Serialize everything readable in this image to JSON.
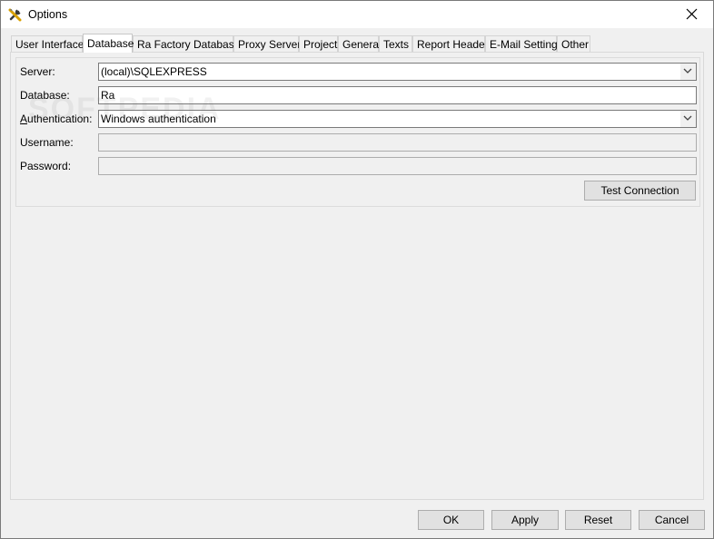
{
  "window": {
    "title": "Options"
  },
  "tabs": [
    {
      "label": "User Interface"
    },
    {
      "label": "Database"
    },
    {
      "label": "Ra Factory Database"
    },
    {
      "label": "Proxy Server"
    },
    {
      "label": "Project"
    },
    {
      "label": "General"
    },
    {
      "label": "Texts"
    },
    {
      "label": "Report Header"
    },
    {
      "label": "E-Mail Settings"
    },
    {
      "label": "Other"
    }
  ],
  "active_tab": "Database",
  "form": {
    "server": {
      "label": "Server:",
      "value": "(local)\\SQLEXPRESS"
    },
    "database": {
      "label": "Database:",
      "value": "Ra"
    },
    "authentication": {
      "label_prefix": "A",
      "label_rest": "uthentication:",
      "value": "Windows authentication"
    },
    "username": {
      "label": "Username:",
      "value": ""
    },
    "password": {
      "label": "Password:",
      "value": ""
    },
    "test_connection_label": "Test Connection"
  },
  "buttons": {
    "ok": "OK",
    "apply": "Apply",
    "reset": "Reset",
    "cancel": "Cancel"
  },
  "watermark": "SOFTPEDIA",
  "icons": {
    "app": "tools-icon",
    "close": "close-icon",
    "dropdown": "chevron-down-icon"
  }
}
